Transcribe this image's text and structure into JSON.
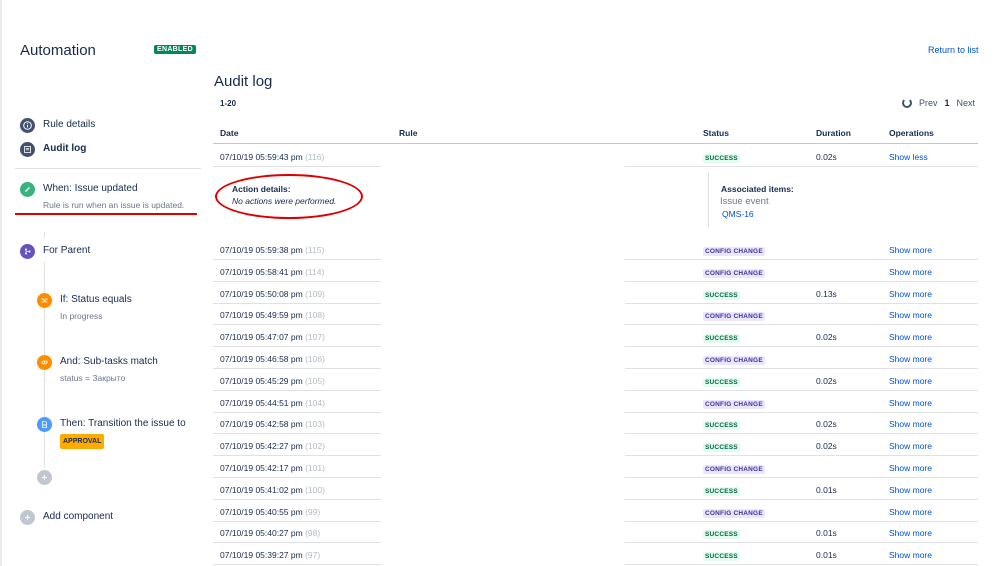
{
  "header": {
    "app_title": "Automation",
    "status_badge": "ENABLED",
    "return_link": "Return to list"
  },
  "sidebar": {
    "rule_details": "Rule details",
    "audit_log": "Audit log",
    "trigger": {
      "label": "When: Issue updated",
      "sub": "Rule is run when an issue is updated."
    },
    "branch": {
      "label": "For Parent"
    },
    "condition1": {
      "label": "If: Status equals",
      "sub": "In progress"
    },
    "condition2": {
      "label": "And: Sub-tasks match",
      "sub": "status = Закрыто"
    },
    "action": {
      "label": "Then: Transition the issue to",
      "badge": "APPROVAL"
    },
    "add_component": "Add component"
  },
  "main": {
    "title": "Audit log",
    "range": "1-20",
    "pager": {
      "prev": "Prev",
      "page": "1",
      "next": "Next"
    },
    "columns": {
      "date": "Date",
      "rule": "Rule",
      "status": "Status",
      "duration": "Duration",
      "operations": "Operations"
    },
    "expanded": {
      "action_title": "Action details:",
      "action_text": "No actions were performed.",
      "assoc_title": "Associated items:",
      "assoc_type": "Issue event",
      "assoc_link": "QMS-16"
    },
    "rows": [
      {
        "date": "07/10/19 05:59:43 pm",
        "id": "(116)",
        "status": "SUCCESS",
        "duration": "0.02s",
        "op": "Show less"
      },
      {
        "date": "07/10/19 05:59:38 pm",
        "id": "(115)",
        "status": "CONFIG CHANGE",
        "duration": "",
        "op": "Show more"
      },
      {
        "date": "07/10/19 05:58:41 pm",
        "id": "(114)",
        "status": "CONFIG CHANGE",
        "duration": "",
        "op": "Show more"
      },
      {
        "date": "07/10/19 05:50:08 pm",
        "id": "(109)",
        "status": "SUCCESS",
        "duration": "0.13s",
        "op": "Show more"
      },
      {
        "date": "07/10/19 05:49:59 pm",
        "id": "(108)",
        "status": "CONFIG CHANGE",
        "duration": "",
        "op": "Show more"
      },
      {
        "date": "07/10/19 05:47:07 pm",
        "id": "(107)",
        "status": "SUCCESS",
        "duration": "0.02s",
        "op": "Show more"
      },
      {
        "date": "07/10/19 05:46:58 pm",
        "id": "(106)",
        "status": "CONFIG CHANGE",
        "duration": "",
        "op": "Show more"
      },
      {
        "date": "07/10/19 05:45:29 pm",
        "id": "(105)",
        "status": "SUCCESS",
        "duration": "0.02s",
        "op": "Show more"
      },
      {
        "date": "07/10/19 05:44:51 pm",
        "id": "(104)",
        "status": "CONFIG CHANGE",
        "duration": "",
        "op": "Show more"
      },
      {
        "date": "07/10/19 05:42:58 pm",
        "id": "(103)",
        "status": "SUCCESS",
        "duration": "0.02s",
        "op": "Show more"
      },
      {
        "date": "07/10/19 05:42:27 pm",
        "id": "(102)",
        "status": "SUCCESS",
        "duration": "0.02s",
        "op": "Show more"
      },
      {
        "date": "07/10/19 05:42:17 pm",
        "id": "(101)",
        "status": "CONFIG CHANGE",
        "duration": "",
        "op": "Show more"
      },
      {
        "date": "07/10/19 05:41:02 pm",
        "id": "(100)",
        "status": "SUCCESS",
        "duration": "0.01s",
        "op": "Show more"
      },
      {
        "date": "07/10/19 05:40:55 pm",
        "id": "(99)",
        "status": "CONFIG CHANGE",
        "duration": "",
        "op": "Show more"
      },
      {
        "date": "07/10/19 05:40:27 pm",
        "id": "(98)",
        "status": "SUCCESS",
        "duration": "0.01s",
        "op": "Show more"
      },
      {
        "date": "07/10/19 05:39:27 pm",
        "id": "(97)",
        "status": "SUCCESS",
        "duration": "0.01s",
        "op": "Show more"
      }
    ]
  },
  "colors": {
    "success": "#006644",
    "config_change": "#403294",
    "link": "#0052cc",
    "enabled": "#00875a",
    "annotation": "#de0000"
  }
}
